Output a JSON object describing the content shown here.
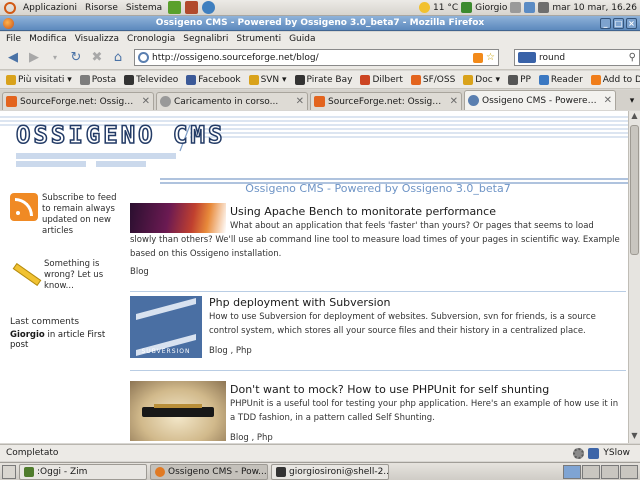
{
  "gnome_panel": {
    "menus": [
      "Applicazioni",
      "Risorse",
      "Sistema"
    ],
    "weather": "11 °C",
    "user": "Giorgio",
    "clock": "mar 10 mar, 16.26"
  },
  "window": {
    "title": "Ossigeno CMS - Powered by Ossigeno 3.0_beta7 - Mozilla Firefox"
  },
  "menubar": [
    "File",
    "Modifica",
    "Visualizza",
    "Cronologia",
    "Segnalibri",
    "Strumenti",
    "Guida"
  ],
  "navbar": {
    "url": "http://ossigeno.sourceforge.net/blog/",
    "search_value": "round"
  },
  "bookmarks": [
    {
      "label": "Più visitati ▾",
      "color": "#d9a21b"
    },
    {
      "label": "Posta",
      "color": "#7d7d7d"
    },
    {
      "label": "Televideo",
      "color": "#333333"
    },
    {
      "label": "Facebook",
      "color": "#3b5998"
    },
    {
      "label": "SVN ▾",
      "color": "#d9a21b"
    },
    {
      "label": "Pirate Bay",
      "color": "#333333"
    },
    {
      "label": "Dilbert",
      "color": "#cc4422"
    },
    {
      "label": "SF/OSS",
      "color": "#e3641e"
    },
    {
      "label": "Doc ▾",
      "color": "#d9a21b"
    },
    {
      "label": "PP",
      "color": "#555555"
    },
    {
      "label": "Reader",
      "color": "#3b78c2"
    },
    {
      "label": "Add to DZone",
      "color": "#f07d1a"
    }
  ],
  "tabs": [
    {
      "label": "SourceForge.net: Ossigeno...",
      "color": "#e3641e"
    },
    {
      "label": "Caricamento in corso...",
      "color": "#999999"
    },
    {
      "label": "SourceForge.net: Ossigeno...",
      "color": "#e3641e"
    },
    {
      "label": "Ossigeno CMS - Powered b...",
      "color": "#5a7fb0"
    }
  ],
  "page": {
    "logo": "OSSIGENO CMS",
    "site_title": "Ossigeno CMS - Powered by Ossigeno 3.0_beta7",
    "sidebar": {
      "subscribe": "Subscribe to feed to remain always updated on new articles",
      "report": "Something is wrong? Let us know...",
      "last_comments_title": "Last comments",
      "last_comment_author": "Giorgio",
      "last_comment_rest": " in article First post"
    },
    "articles": [
      {
        "title": "Using Apache Bench to monitorate performance",
        "body": "What about an application that feels 'faster' than yours? Or pages that seems to load slowly than others? We'll use ab command line tool to measure load times of your pages in scientific way. Example based on this Ossigeno installation.",
        "tags": "Blog"
      },
      {
        "title": "Php deployment with Subversion",
        "body": "How to use Subversion for deployment of websites. Subversion, svn for friends, is a source control system, which stores all your source files and their history in a centralized place.",
        "tags": "Blog , Php",
        "thumb_label": "SUBVERSION"
      },
      {
        "title": "Don't want to mock? How to use PHPUnit for self shunting",
        "body": "PHPUnit is a useful tool for testing your php application. Here's an example of how use it in a TDD fashion, in a pattern called Self Shunting.",
        "tags": "Blog , Php"
      }
    ]
  },
  "statusbar": {
    "status": "Completato",
    "yslow": "YSlow"
  },
  "taskbar": [
    {
      "label": ":Oggi - Zim",
      "color": "#4f7c2c"
    },
    {
      "label": "Ossigeno CMS - Pow...",
      "color": "#e07a24"
    },
    {
      "label": "giorgiosironi@shell-2...",
      "color": "#333333"
    }
  ]
}
